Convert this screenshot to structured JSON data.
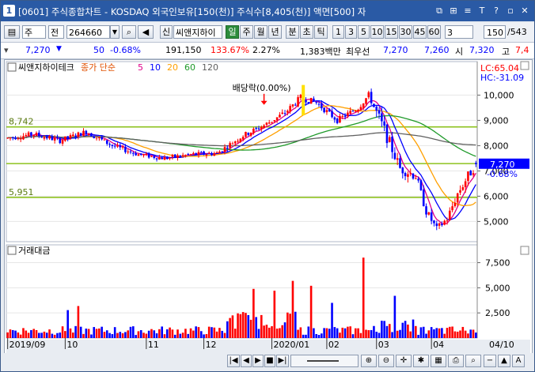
{
  "window": {
    "number": "1",
    "title": "[0601] 주식종합차트 - KOSDAQ 외국인보유[150(천)] 주식수[8,405(천)] 액면[500] 자",
    "buttons": [
      "⧉",
      "⊞",
      "≡",
      "T",
      "?",
      "▫",
      "✕"
    ]
  },
  "toolbar": {
    "market": "주",
    "mode": "전",
    "code": "264660",
    "stock_name": "씨앤지하이",
    "flag_badge": "신",
    "periods": [
      "일",
      "주",
      "월",
      "년",
      "분",
      "초",
      "틱"
    ],
    "active_period": "일",
    "intervals": [
      "1",
      "3",
      "5",
      "10",
      "15",
      "30",
      "45",
      "60"
    ],
    "interval_select": "3",
    "page_count": "150",
    "page_total": "/543"
  },
  "quote": {
    "price": "7,270",
    "arrow": "▼",
    "change": "50",
    "change_pct": "-0.68%",
    "volume": "191,150",
    "vol_ratio": "133.67%",
    "turnover_pct": "2.27%",
    "amount": "1,383백만",
    "best_label": "최우선",
    "ask": "7,270",
    "bid": "7,260",
    "open_label": "시",
    "open": "7,320",
    "high_label": "고",
    "high": "7,4"
  },
  "chart_data": {
    "type": "candlestick",
    "legend": {
      "name": "씨앤지하이테크",
      "ma_label": "종가 단순",
      "ma_periods": [
        "5",
        "10",
        "20",
        "60",
        "120"
      ],
      "ma_colors": [
        "#e0008a",
        "#0000ff",
        "#ffa000",
        "#1f9a2a",
        "#606060"
      ]
    },
    "annotation": "배당락(0.00%)",
    "lc_label": "LC:65.04",
    "hc_label": "HC:-31.09",
    "price_axis": [
      "10,000",
      "9,000",
      "8,000",
      "7,000",
      "6,000",
      "5,000"
    ],
    "price_range": [
      4200,
      11200
    ],
    "hlines": [
      {
        "value": 8742,
        "label": "8,742"
      },
      {
        "value": 7290,
        "label": ""
      },
      {
        "value": 5951,
        "label": "5,951"
      }
    ],
    "hline_color": "#8dc21f",
    "current_price_label": "7,270",
    "current_change_label": "-0.68%",
    "volume_title": "거래대금",
    "volume_axis": [
      "7,500",
      "5,000",
      "2,500"
    ],
    "volume_range": [
      0,
      8800
    ],
    "x_labels": [
      "2019/09",
      "10",
      "11",
      "12",
      "2020/01",
      "02",
      "03",
      "04"
    ],
    "x_label_days": [
      0,
      22,
      53,
      75,
      101,
      122,
      141,
      162
    ],
    "x_end_label": "04/10",
    "days": 180,
    "up_color": "#ff0000",
    "down_color": "#0000ff"
  }
}
